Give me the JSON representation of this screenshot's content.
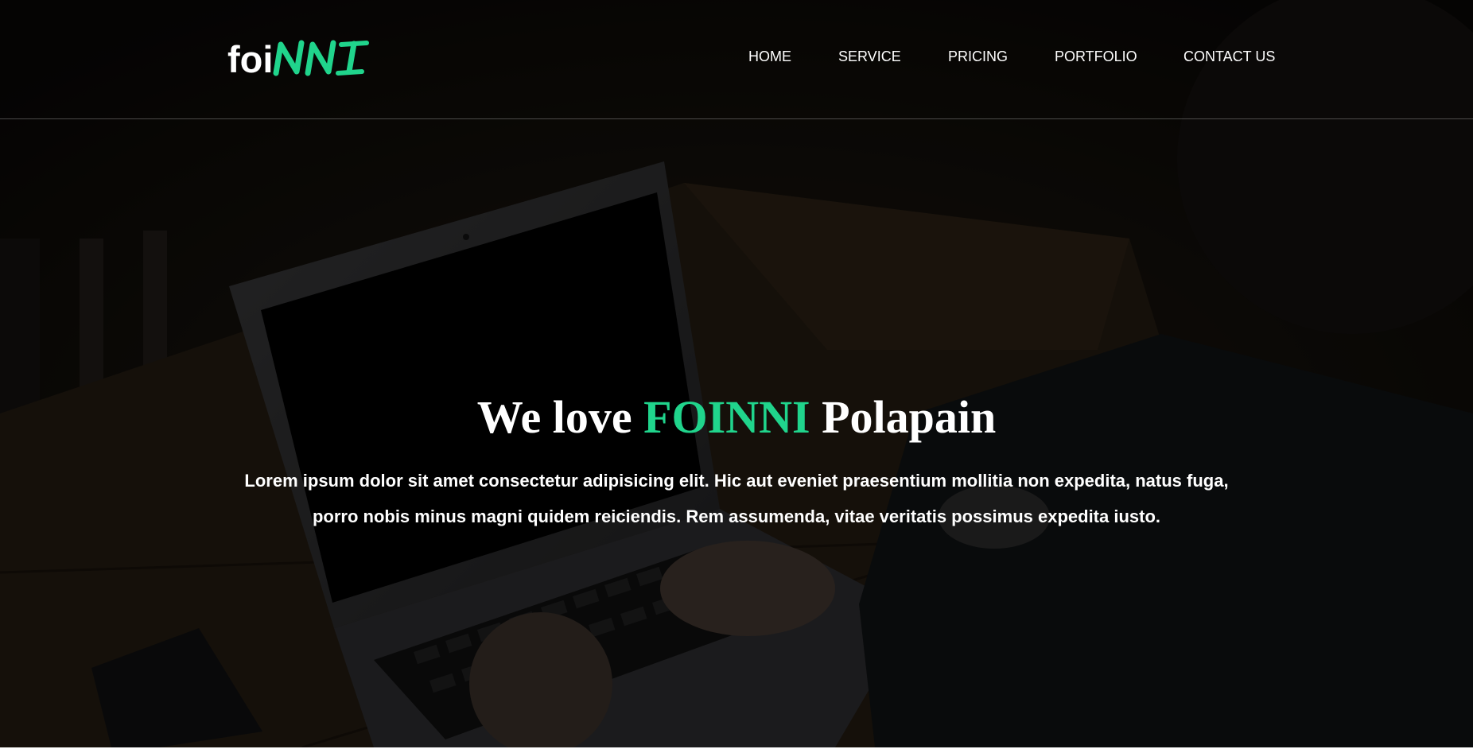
{
  "brand": {
    "logo_plain": "foi",
    "logo_script": "NNI",
    "accent_color": "#20d48c"
  },
  "nav": {
    "items": [
      {
        "label": "HOME"
      },
      {
        "label": "SERVICE"
      },
      {
        "label": "PRICING"
      },
      {
        "label": "PORTFOLIO"
      },
      {
        "label": "CONTACT US"
      }
    ]
  },
  "hero": {
    "headline_pre": "We love",
    "headline_accent": "FOINNI",
    "headline_post": "Polapain",
    "paragraph": "Lorem ipsum dolor sit amet consectetur adipisicing elit. Hic aut eveniet praesentium mollitia non expedita, natus fuga, porro nobis minus magni quidem reiciendis. Rem assumenda, vitae veritatis possimus expedita iusto.",
    "background_image": "dark photo of hands typing on a laptop on a wooden table"
  }
}
